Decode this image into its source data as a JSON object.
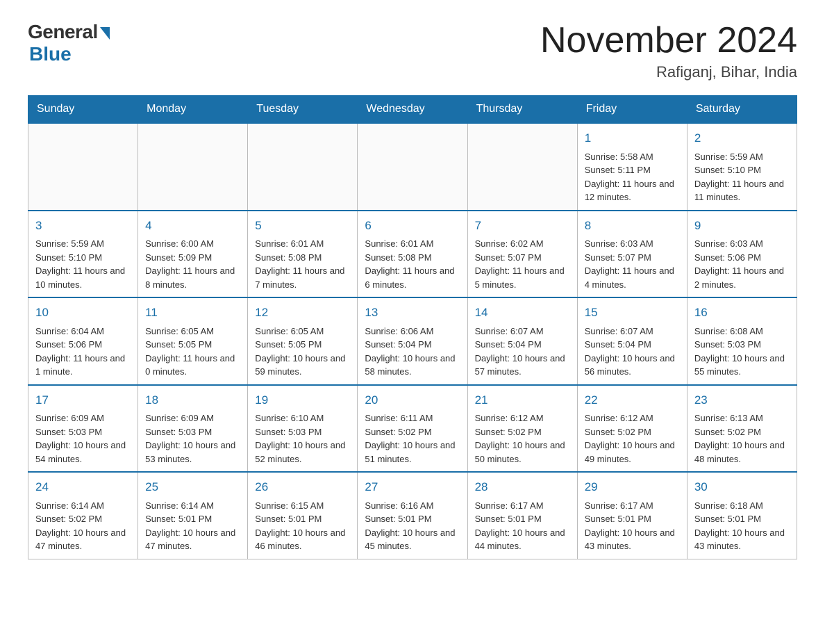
{
  "header": {
    "logo_general": "General",
    "logo_blue": "Blue",
    "title": "November 2024",
    "subtitle": "Rafiganj, Bihar, India"
  },
  "weekdays": [
    "Sunday",
    "Monday",
    "Tuesday",
    "Wednesday",
    "Thursday",
    "Friday",
    "Saturday"
  ],
  "weeks": [
    [
      {
        "day": null,
        "sunrise": null,
        "sunset": null,
        "daylight": null
      },
      {
        "day": null,
        "sunrise": null,
        "sunset": null,
        "daylight": null
      },
      {
        "day": null,
        "sunrise": null,
        "sunset": null,
        "daylight": null
      },
      {
        "day": null,
        "sunrise": null,
        "sunset": null,
        "daylight": null
      },
      {
        "day": null,
        "sunrise": null,
        "sunset": null,
        "daylight": null
      },
      {
        "day": "1",
        "sunrise": "Sunrise: 5:58 AM",
        "sunset": "Sunset: 5:11 PM",
        "daylight": "Daylight: 11 hours and 12 minutes."
      },
      {
        "day": "2",
        "sunrise": "Sunrise: 5:59 AM",
        "sunset": "Sunset: 5:10 PM",
        "daylight": "Daylight: 11 hours and 11 minutes."
      }
    ],
    [
      {
        "day": "3",
        "sunrise": "Sunrise: 5:59 AM",
        "sunset": "Sunset: 5:10 PM",
        "daylight": "Daylight: 11 hours and 10 minutes."
      },
      {
        "day": "4",
        "sunrise": "Sunrise: 6:00 AM",
        "sunset": "Sunset: 5:09 PM",
        "daylight": "Daylight: 11 hours and 8 minutes."
      },
      {
        "day": "5",
        "sunrise": "Sunrise: 6:01 AM",
        "sunset": "Sunset: 5:08 PM",
        "daylight": "Daylight: 11 hours and 7 minutes."
      },
      {
        "day": "6",
        "sunrise": "Sunrise: 6:01 AM",
        "sunset": "Sunset: 5:08 PM",
        "daylight": "Daylight: 11 hours and 6 minutes."
      },
      {
        "day": "7",
        "sunrise": "Sunrise: 6:02 AM",
        "sunset": "Sunset: 5:07 PM",
        "daylight": "Daylight: 11 hours and 5 minutes."
      },
      {
        "day": "8",
        "sunrise": "Sunrise: 6:03 AM",
        "sunset": "Sunset: 5:07 PM",
        "daylight": "Daylight: 11 hours and 4 minutes."
      },
      {
        "day": "9",
        "sunrise": "Sunrise: 6:03 AM",
        "sunset": "Sunset: 5:06 PM",
        "daylight": "Daylight: 11 hours and 2 minutes."
      }
    ],
    [
      {
        "day": "10",
        "sunrise": "Sunrise: 6:04 AM",
        "sunset": "Sunset: 5:06 PM",
        "daylight": "Daylight: 11 hours and 1 minute."
      },
      {
        "day": "11",
        "sunrise": "Sunrise: 6:05 AM",
        "sunset": "Sunset: 5:05 PM",
        "daylight": "Daylight: 11 hours and 0 minutes."
      },
      {
        "day": "12",
        "sunrise": "Sunrise: 6:05 AM",
        "sunset": "Sunset: 5:05 PM",
        "daylight": "Daylight: 10 hours and 59 minutes."
      },
      {
        "day": "13",
        "sunrise": "Sunrise: 6:06 AM",
        "sunset": "Sunset: 5:04 PM",
        "daylight": "Daylight: 10 hours and 58 minutes."
      },
      {
        "day": "14",
        "sunrise": "Sunrise: 6:07 AM",
        "sunset": "Sunset: 5:04 PM",
        "daylight": "Daylight: 10 hours and 57 minutes."
      },
      {
        "day": "15",
        "sunrise": "Sunrise: 6:07 AM",
        "sunset": "Sunset: 5:04 PM",
        "daylight": "Daylight: 10 hours and 56 minutes."
      },
      {
        "day": "16",
        "sunrise": "Sunrise: 6:08 AM",
        "sunset": "Sunset: 5:03 PM",
        "daylight": "Daylight: 10 hours and 55 minutes."
      }
    ],
    [
      {
        "day": "17",
        "sunrise": "Sunrise: 6:09 AM",
        "sunset": "Sunset: 5:03 PM",
        "daylight": "Daylight: 10 hours and 54 minutes."
      },
      {
        "day": "18",
        "sunrise": "Sunrise: 6:09 AM",
        "sunset": "Sunset: 5:03 PM",
        "daylight": "Daylight: 10 hours and 53 minutes."
      },
      {
        "day": "19",
        "sunrise": "Sunrise: 6:10 AM",
        "sunset": "Sunset: 5:03 PM",
        "daylight": "Daylight: 10 hours and 52 minutes."
      },
      {
        "day": "20",
        "sunrise": "Sunrise: 6:11 AM",
        "sunset": "Sunset: 5:02 PM",
        "daylight": "Daylight: 10 hours and 51 minutes."
      },
      {
        "day": "21",
        "sunrise": "Sunrise: 6:12 AM",
        "sunset": "Sunset: 5:02 PM",
        "daylight": "Daylight: 10 hours and 50 minutes."
      },
      {
        "day": "22",
        "sunrise": "Sunrise: 6:12 AM",
        "sunset": "Sunset: 5:02 PM",
        "daylight": "Daylight: 10 hours and 49 minutes."
      },
      {
        "day": "23",
        "sunrise": "Sunrise: 6:13 AM",
        "sunset": "Sunset: 5:02 PM",
        "daylight": "Daylight: 10 hours and 48 minutes."
      }
    ],
    [
      {
        "day": "24",
        "sunrise": "Sunrise: 6:14 AM",
        "sunset": "Sunset: 5:02 PM",
        "daylight": "Daylight: 10 hours and 47 minutes."
      },
      {
        "day": "25",
        "sunrise": "Sunrise: 6:14 AM",
        "sunset": "Sunset: 5:01 PM",
        "daylight": "Daylight: 10 hours and 47 minutes."
      },
      {
        "day": "26",
        "sunrise": "Sunrise: 6:15 AM",
        "sunset": "Sunset: 5:01 PM",
        "daylight": "Daylight: 10 hours and 46 minutes."
      },
      {
        "day": "27",
        "sunrise": "Sunrise: 6:16 AM",
        "sunset": "Sunset: 5:01 PM",
        "daylight": "Daylight: 10 hours and 45 minutes."
      },
      {
        "day": "28",
        "sunrise": "Sunrise: 6:17 AM",
        "sunset": "Sunset: 5:01 PM",
        "daylight": "Daylight: 10 hours and 44 minutes."
      },
      {
        "day": "29",
        "sunrise": "Sunrise: 6:17 AM",
        "sunset": "Sunset: 5:01 PM",
        "daylight": "Daylight: 10 hours and 43 minutes."
      },
      {
        "day": "30",
        "sunrise": "Sunrise: 6:18 AM",
        "sunset": "Sunset: 5:01 PM",
        "daylight": "Daylight: 10 hours and 43 minutes."
      }
    ]
  ]
}
